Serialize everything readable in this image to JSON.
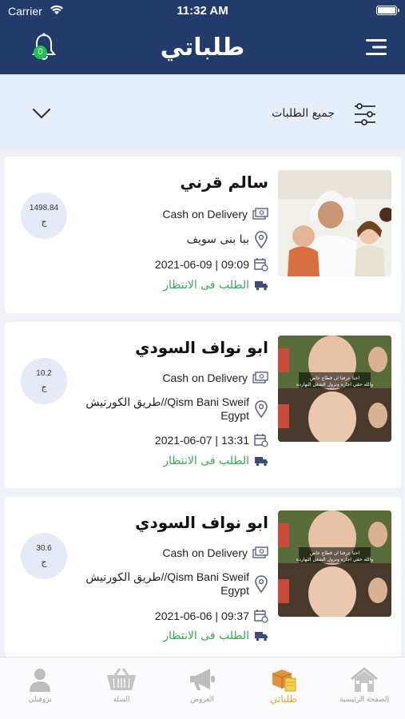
{
  "status_bar": {
    "carrier": "Carrier",
    "time": "11:32 AM"
  },
  "header": {
    "title": "طلباتي",
    "notification_count": "0"
  },
  "filter": {
    "label": "جميع الطلبات"
  },
  "orders": [
    {
      "customer": "سالم قرني",
      "payment": "Cash on Delivery",
      "address": "ببا بنى سويف",
      "datetime": "2021-06-09 | 09:09",
      "status": "الطلب فى الانتظار",
      "amount": "1498.84",
      "currency": "ج"
    },
    {
      "customer": "ابو نواف السودي",
      "payment": "Cash on Delivery",
      "address_line1": "طريق الكورنيش//Qism Bani Sweif",
      "address_line2": "Egypt",
      "datetime": "2021-06-07 | 13:31",
      "status": "الطلب فى الانتظار",
      "amount": "10.2",
      "currency": "ج"
    },
    {
      "customer": "ابو نواف السودي",
      "payment": "Cash on Delivery",
      "address_line1": "طريق الكورنيش//Qism Bani Sweif",
      "address_line2": "Egypt",
      "datetime": "2021-06-06 | 09:37",
      "status": "الطلب فى الانتظار",
      "amount": "30.6",
      "currency": "ج"
    }
  ],
  "tabbar": {
    "home": "الصفحة الرئيسية",
    "orders": "طلباتي",
    "offers": "العروض",
    "cart": "السلة",
    "profile": "بروفيلي"
  },
  "colors": {
    "header": "#233b6b",
    "accent": "#f0a326",
    "status_green": "#3aa957",
    "badge": "#1fc24c"
  }
}
